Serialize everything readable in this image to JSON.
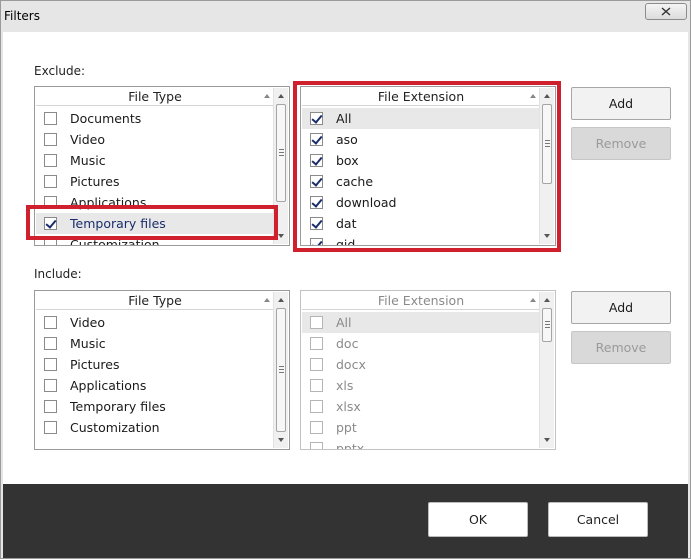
{
  "window": {
    "title": "Filters"
  },
  "exclude": {
    "label": "Exclude:",
    "file_type": {
      "header": "File Type",
      "items": [
        {
          "label": "Documents",
          "checked": false
        },
        {
          "label": "Video",
          "checked": false
        },
        {
          "label": "Music",
          "checked": false
        },
        {
          "label": "Pictures",
          "checked": false
        },
        {
          "label": "Applications",
          "checked": false
        },
        {
          "label": "Temporary files",
          "checked": true
        },
        {
          "label": "Customization",
          "checked": false
        }
      ]
    },
    "file_extension": {
      "header": "File Extension",
      "items": [
        {
          "label": "All",
          "checked": true
        },
        {
          "label": "aso",
          "checked": true
        },
        {
          "label": "box",
          "checked": true
        },
        {
          "label": "cache",
          "checked": true
        },
        {
          "label": "download",
          "checked": true
        },
        {
          "label": "dat",
          "checked": true
        },
        {
          "label": "gid",
          "checked": true
        }
      ]
    },
    "add_label": "Add",
    "remove_label": "Remove"
  },
  "include": {
    "label": "Include:",
    "file_type": {
      "header": "File Type",
      "items": [
        {
          "label": "Video",
          "checked": false
        },
        {
          "label": "Music",
          "checked": false
        },
        {
          "label": "Pictures",
          "checked": false
        },
        {
          "label": "Applications",
          "checked": false
        },
        {
          "label": "Temporary files",
          "checked": false
        },
        {
          "label": "Customization",
          "checked": false
        }
      ]
    },
    "file_extension": {
      "header": "File Extension",
      "items": [
        {
          "label": "All",
          "checked": false
        },
        {
          "label": "doc",
          "checked": false
        },
        {
          "label": "docx",
          "checked": false
        },
        {
          "label": "xls",
          "checked": false
        },
        {
          "label": "xlsx",
          "checked": false
        },
        {
          "label": "ppt",
          "checked": false
        },
        {
          "label": "pptx",
          "checked": false
        }
      ]
    },
    "add_label": "Add",
    "remove_label": "Remove"
  },
  "footer": {
    "ok_label": "OK",
    "cancel_label": "Cancel"
  },
  "colors": {
    "highlight": "#d0202e",
    "footer_bg": "#333333",
    "check": "#1a2d6b"
  }
}
